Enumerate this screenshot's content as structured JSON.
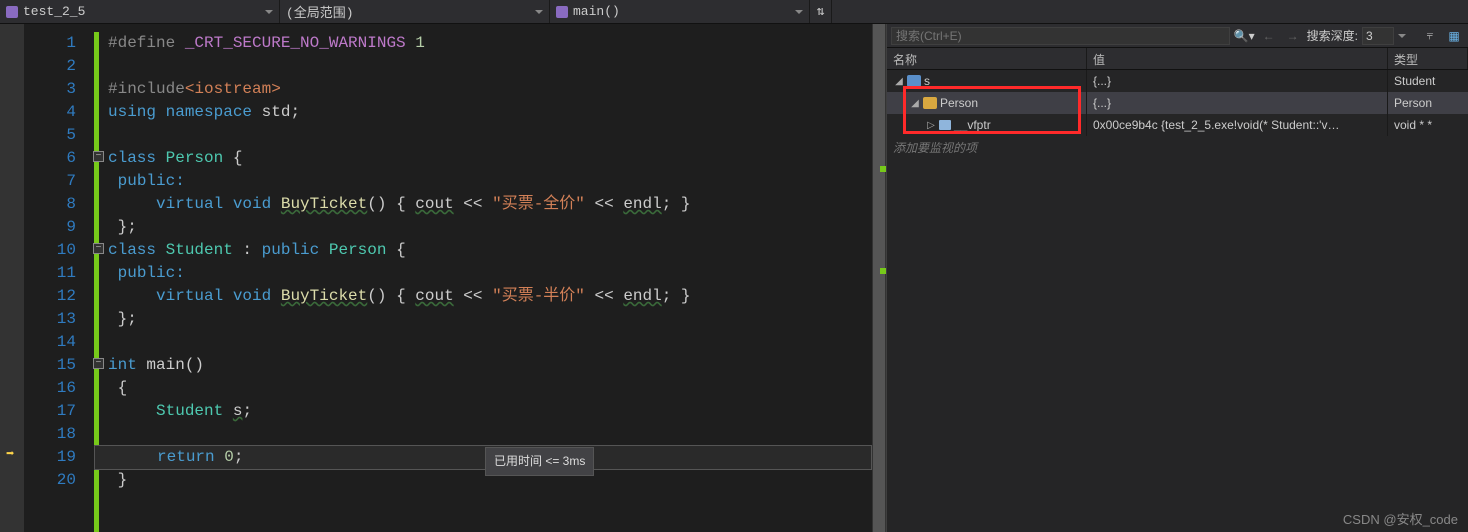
{
  "topbar": {
    "project": "test_2_5",
    "scope": "(全局范围)",
    "function": "main()"
  },
  "code": {
    "lines": [
      1,
      2,
      3,
      4,
      5,
      6,
      7,
      8,
      9,
      10,
      11,
      12,
      13,
      14,
      15,
      16,
      17,
      18,
      19,
      20
    ],
    "l1_pp": "#define ",
    "l1_mac": "_CRT_SECURE_NO_WARNINGS",
    "l1_n": " 1",
    "l3_pp": "#include",
    "l3_inc": "<iostream>",
    "l4_a": "using ",
    "l4_b": "namespace ",
    "l4_c": "std",
    "l4_d": ";",
    "l6_a": "class ",
    "l6_b": "Person",
    "l6_c": " {",
    "l7": "public:",
    "l8_a": "    ",
    "l8_b": "virtual ",
    "l8_c": "void ",
    "l8_d": "BuyTicket",
    "l8_e": "() { ",
    "l8_f": "cout",
    "l8_g": " << ",
    "l8_h": "\"买票-全价\"",
    "l8_i": " << ",
    "l8_j": "endl",
    "l8_k": "; }",
    "l9": "};",
    "l10_a": "class ",
    "l10_b": "Student",
    "l10_c": " : ",
    "l10_d": "public ",
    "l10_e": "Person",
    "l10_f": " {",
    "l11": "public:",
    "l12_a": "    ",
    "l12_b": "virtual ",
    "l12_c": "void ",
    "l12_d": "BuyTicket",
    "l12_e": "() { ",
    "l12_f": "cout",
    "l12_g": " << ",
    "l12_h": "\"买票-半价\"",
    "l12_i": " << ",
    "l12_j": "endl",
    "l12_k": "; }",
    "l13": "};",
    "l15_a": "int ",
    "l15_b": "main",
    "l15_c": "()",
    "l16": "{",
    "l17_a": "    ",
    "l17_b": "Student",
    "l17_c": " ",
    "l17_d": "s",
    "l17_e": ";",
    "l19_a": "    ",
    "l19_b": "return ",
    "l19_c": "0",
    "l19_d": ";",
    "l20": "}",
    "tooltip": "已用时间 <= 3ms",
    "current_line": 19
  },
  "watch": {
    "search_placeholder": "搜索(Ctrl+E)",
    "depth_label": "搜索深度:",
    "depth_value": "3",
    "headers": {
      "name": "名称",
      "value": "值",
      "type": "类型"
    },
    "rows": [
      {
        "indent": 0,
        "expanded": true,
        "icon": "obj",
        "name": "s",
        "value": "{...}",
        "type": "Student"
      },
      {
        "indent": 1,
        "expanded": true,
        "icon": "obj-y",
        "name": "Person",
        "value": "{...}",
        "type": "Person",
        "selected": true
      },
      {
        "indent": 2,
        "expanded": false,
        "icon": "fld",
        "name": "__vfptr",
        "value": "0x00ce9b4c {test_2_5.exe!void(* Student::'v…",
        "type": "void * *"
      }
    ],
    "add_placeholder": "添加要监视的项"
  },
  "watermark": "CSDN @安权_code"
}
